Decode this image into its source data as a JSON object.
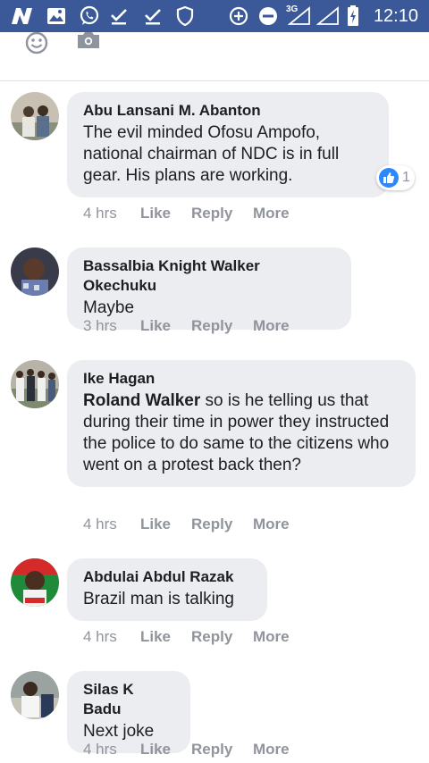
{
  "status_bar": {
    "time": "12:10",
    "network": "3G",
    "bg_color": "#3b5998"
  },
  "comments": [
    {
      "author": "Abu Lansani M. Abanton",
      "mention": "",
      "text": "The evil minded Ofosu Ampofo, national chairman of NDC is in full gear. His plans are working.",
      "time": "4 hrs",
      "like": "Like",
      "reply": "Reply",
      "more": "More",
      "reaction_count": "1"
    },
    {
      "author": "Bassalbia Knight Walker Okechuku",
      "mention": "",
      "text": "Maybe",
      "time": "3 hrs",
      "like": "Like",
      "reply": "Reply",
      "more": "More"
    },
    {
      "author": "Ike Hagan",
      "mention": "Roland Walker",
      "text": " so is he telling us that during their time in power they instructed the police to do same to the citizens who went on a protest back then?",
      "time": "4 hrs",
      "like": "Like",
      "reply": "Reply",
      "more": "More"
    },
    {
      "author": "Abdulai Abdul Razak",
      "mention": "",
      "text": "Brazil man is talking",
      "time": "4 hrs",
      "like": "Like",
      "reply": "Reply",
      "more": "More"
    },
    {
      "author": "Silas K Badu",
      "mention": "",
      "text": "Next joke",
      "time": "4 hrs",
      "like": "Like",
      "reply": "Reply",
      "more": "More"
    }
  ]
}
